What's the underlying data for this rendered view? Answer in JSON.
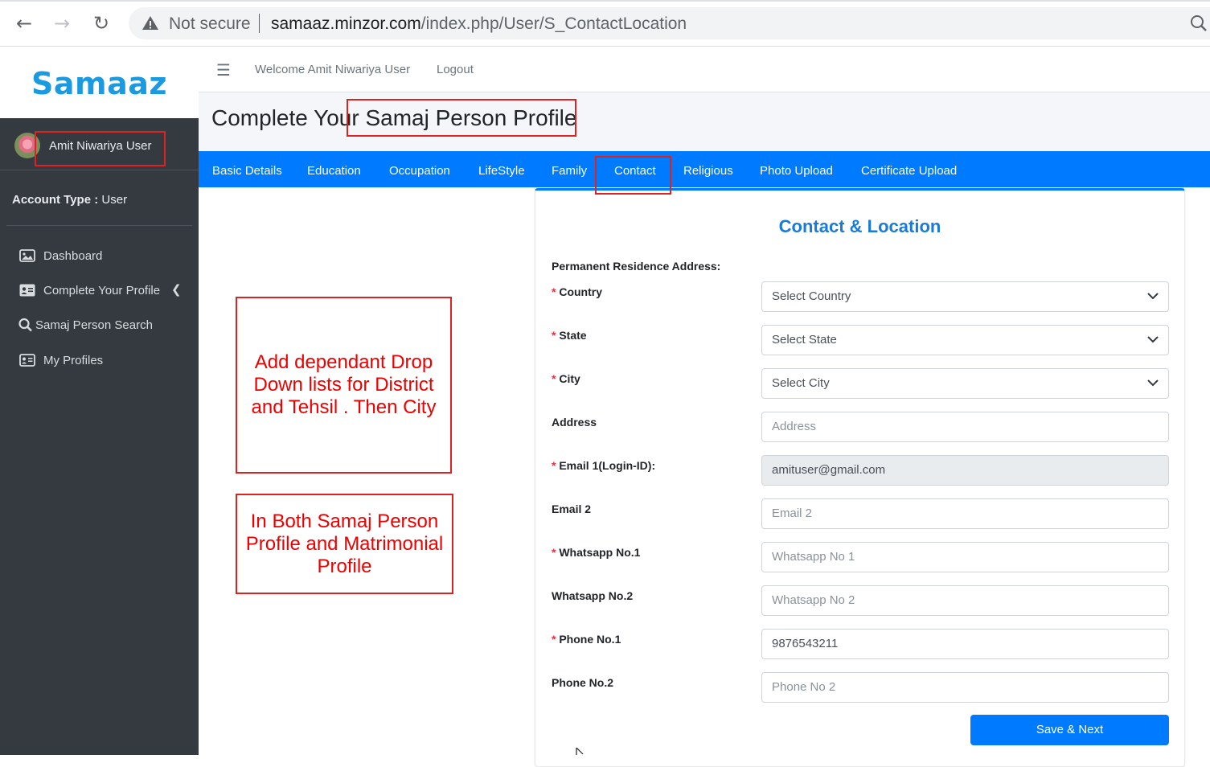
{
  "browser": {
    "security_label": "Not secure",
    "url_host": "samaaz.minzor.com",
    "url_path": "/index.php/User/S_ContactLocation"
  },
  "sidebar": {
    "brand": "Samaaz",
    "user_name": "Amit Niwariya User",
    "account_type_label": "Account Type :",
    "account_type_value": " User",
    "items": [
      {
        "label": "Dashboard",
        "icon": "image-icon"
      },
      {
        "label": "Complete Your Profile",
        "icon": "id-card-icon"
      },
      {
        "label": "Samaj Person Search",
        "icon": "search-icon"
      },
      {
        "label": "My Profiles",
        "icon": "id-card-icon"
      }
    ]
  },
  "topbar": {
    "welcome": "Welcome  Amit Niwariya User",
    "logout": "Logout"
  },
  "page": {
    "title": "Complete Your Samaj Person Profile"
  },
  "tabs": [
    "Basic Details",
    "Education",
    "Occupation",
    "LifeStyle",
    "Family",
    "Contact",
    "Religious",
    "Photo Upload",
    "Certificate Upload"
  ],
  "form": {
    "title": "Contact & Location",
    "section": "Permanent Residence Address:",
    "fields": [
      {
        "label": "Country",
        "required": true,
        "value": "Select Country"
      },
      {
        "label": "State",
        "required": true,
        "value": "Select State"
      },
      {
        "label": "City",
        "required": true,
        "value": "Select City"
      },
      {
        "label": "Address",
        "required": false,
        "placeholder": "Address"
      },
      {
        "label": "Email 1(Login-ID):",
        "required": true,
        "value": "amituser@gmail.com"
      },
      {
        "label": "Email 2",
        "required": false,
        "placeholder": "Email 2"
      },
      {
        "label": "Whatsapp No.1",
        "required": true,
        "placeholder": "Whatsapp No 1"
      },
      {
        "label": "Whatsapp No.2",
        "required": false,
        "placeholder": "Whatsapp No 2"
      },
      {
        "label": "Phone No.1",
        "required": true,
        "value": "9876543211"
      },
      {
        "label": "Phone No.2",
        "required": false,
        "placeholder": "Phone No 2"
      }
    ],
    "required_mark": "*",
    "submit": "Save & Next"
  },
  "annotations": {
    "note1": "Add dependant Drop Down lists for District and Tehsil . Then City",
    "note2": "In Both Samaj Person Profile and Matrimonial Profile"
  },
  "colors": {
    "accent": "#007bff",
    "brand": "#1a9ae0",
    "sidebar_bg": "#343a40",
    "annotation": "#dd2222"
  }
}
